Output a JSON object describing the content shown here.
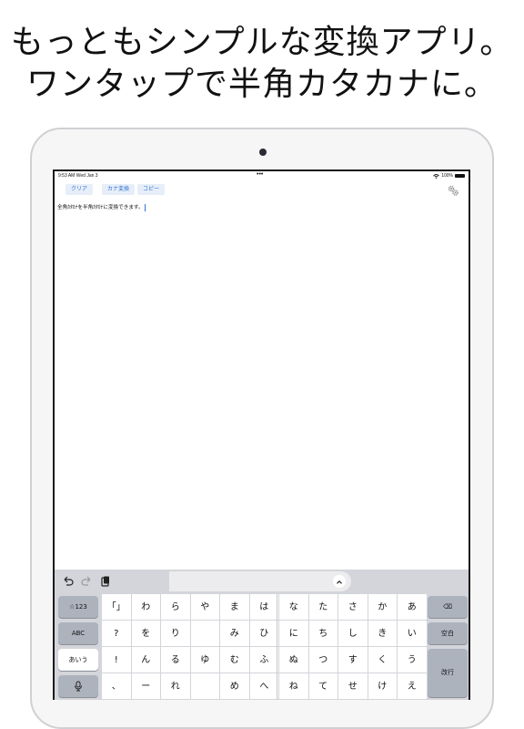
{
  "headline": {
    "line1": "もっともシンプルな変換アプリ。",
    "line2": "ワンタップで半角カタカナに。"
  },
  "status_bar": {
    "time": "9:53 AM   Wed Jan 3",
    "dots": "•••",
    "battery": "100%"
  },
  "toolbar": {
    "clear_label": "クリア",
    "kana_label": "カナ変換",
    "copy_label": "コピー"
  },
  "editor": {
    "text": "全角ｶﾀｶﾅを半角ｶﾀｶﾅに変換できます。"
  },
  "keyboard": {
    "left_keys": [
      "☆123",
      "ABC",
      "あいう",
      "🎤"
    ],
    "right_keys": [
      "⌫",
      "空白",
      "改行"
    ],
    "rows": [
      [
        "「」",
        "わ",
        "ら",
        "や",
        "ま",
        "は",
        "な",
        "た",
        "さ",
        "か",
        "あ"
      ],
      [
        "?",
        "を",
        "り",
        "",
        "み",
        "ひ",
        "に",
        "ち",
        "し",
        "き",
        "い"
      ],
      [
        "!",
        "ん",
        "る",
        "ゆ",
        "む",
        "ふ",
        "ぬ",
        "つ",
        "す",
        "く",
        "う"
      ],
      [
        "、",
        "ー",
        "れ",
        "",
        "め",
        "へ",
        "ね",
        "て",
        "せ",
        "け",
        "え"
      ]
    ]
  },
  "colors": {
    "accent": "#2f74d0",
    "button_bg": "#e7eef9",
    "keyboard_bg": "#d3d5da",
    "side_key": "#adb3bd"
  }
}
